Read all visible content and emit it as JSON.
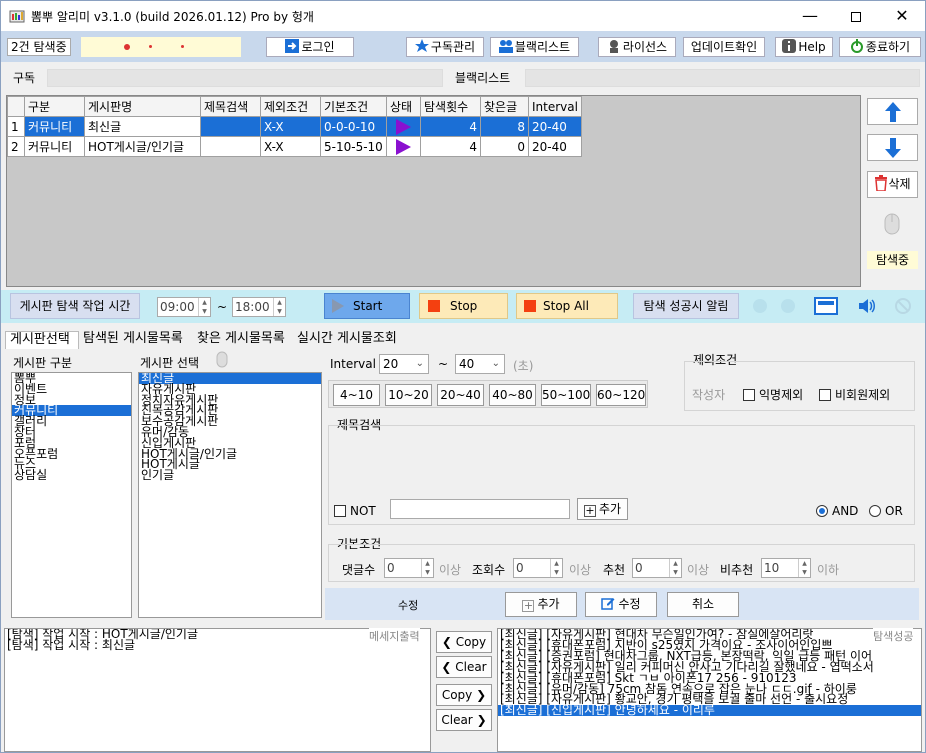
{
  "window": {
    "title": "뽐뿌 알리미 v3.1.0 (build 2026.01.12) Pro by 헝개"
  },
  "toolbar": {
    "status_count": "2건 탐색중",
    "login": "로그인",
    "subscribe": "구독관리",
    "blacklist": "블랙리스트",
    "license": "라이선스",
    "update": "업데이트확인",
    "help": "Help",
    "exit": "종료하기"
  },
  "sections": {
    "subscribe": "구독",
    "blacklist": "블랙리스트"
  },
  "grid": {
    "headers": [
      "",
      "구분",
      "게시판명",
      "제목검색",
      "제외조건",
      "기본조건",
      "상태",
      "탐색횟수",
      "찾은글",
      "Interval"
    ],
    "rows": [
      {
        "no": "1",
        "category": "커뮤니티",
        "board": "최신글",
        "title_search": "",
        "exclude": "X-X",
        "basic": "0-0-0-10",
        "count": "4",
        "found": "8",
        "interval": "20-40"
      },
      {
        "no": "2",
        "category": "커뮤니티",
        "board": "HOT게시글/인기글",
        "title_search": "",
        "exclude": "X-X",
        "basic": "5-10-5-10",
        "count": "4",
        "found": "0",
        "interval": "20-40"
      }
    ]
  },
  "side": {
    "delete": "삭제",
    "status": "탐색중"
  },
  "controls": {
    "work_time_label": "게시판 탐색 작업 시간",
    "time_from": "09:00",
    "tilde": "~",
    "time_to": "18:00",
    "start": "Start",
    "stop": "Stop",
    "stop_all": "Stop All",
    "success_alert": "탐색 성공시 알림"
  },
  "tabs": [
    "게시판선택",
    "탐색된 게시물목록",
    "찾은 게시물목록",
    "실시간 게시물조회"
  ],
  "board_select": {
    "category_label": "게시판 구분",
    "board_label": "게시판 선택",
    "categories": [
      "뽐뿌",
      "이벤트",
      "정보",
      "커뮤니티",
      "갤러리",
      "장터",
      "포럼",
      "오픈포럼",
      "뉴스",
      "상담실"
    ],
    "selected_category": 3,
    "boards": [
      "최신글",
      "자유게시판",
      "정치자유게시판",
      "친목공감게시판",
      "보수공감게시판",
      "유머/감동",
      "신입게시판",
      "HOT게시글/인기글",
      "HOT게시글",
      "인기글"
    ],
    "selected_board": 0
  },
  "interval": {
    "label": "Interval",
    "min": "20",
    "tilde": "~",
    "max": "40",
    "unit": "(초)",
    "presets": [
      "4~10",
      "10~20",
      "20~40",
      "40~80",
      "50~100",
      "60~120"
    ]
  },
  "exclude": {
    "title": "제외조건",
    "author_label": "작성자",
    "anon": "익명제외",
    "nonmember": "비회원제외"
  },
  "title_search": {
    "title": "제목검색",
    "not": "NOT",
    "add": "추가",
    "and": "AND",
    "or": "OR"
  },
  "basic": {
    "title": "기본조건",
    "comments_label": "댓글수",
    "comments": "0",
    "above1": "이상",
    "views_label": "조회수",
    "views": "0",
    "above2": "이상",
    "recommend_label": "추천",
    "recommend": "0",
    "above3": "이상",
    "notrecommend_label": "비추천",
    "notrecommend": "10",
    "below": "이하"
  },
  "actions": {
    "edit_label": "수정",
    "add": "추가",
    "edit": "수정",
    "cancel": "취소"
  },
  "message_log": {
    "label": "메세지출력",
    "lines": [
      "[탐색] 작업 시작 : HOT게시글/인기글",
      "[탐색] 작업 시작 : 최신글"
    ]
  },
  "log_buttons": {
    "copy_left": "Copy",
    "clear_left": "Clear",
    "copy_right": "Copy",
    "clear_right": "Clear"
  },
  "success_log": {
    "label": "탐색성공",
    "lines": [
      "[최신글] [자유게시판] 현대차 무슨일인가여? - 잠실에살어리랏",
      "[최신글] [휴대폰포럼] 지반이 s25였지 가격이요 - 조사이어인입쁘",
      "[최신글] [증권포럼] 현대차그룹, NXT급등, 본장떡락, 익일 급등 패턴 이어",
      "[최신글] [자유게시판] 일리 커피머신 안사고 기다리길 잘했네요 - 엽떡소서",
      "[최신글] [휴대폰포럼] Skt ㄱㅂ 아이폰17 256 - 910123",
      "[최신글] [유머/감동] 75cm 참돔 연속으로 잡은 눈나 ㄷㄷ.gif - 하이룽",
      "[최신글] [자유게시판] 황교안, 경기 평택을 보궐 출마 선언 - 출시요정",
      "[최신글] [신입게시판] 안녕하세요 - 이리루"
    ],
    "selected": 7
  }
}
